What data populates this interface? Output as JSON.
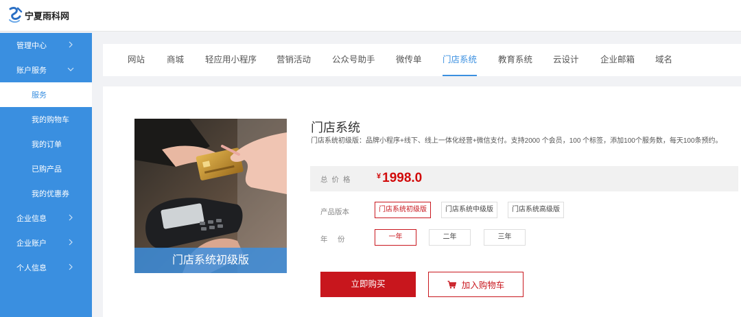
{
  "header": {
    "logo_text": "宁夏雨科网"
  },
  "sidebar": {
    "items": [
      {
        "label": "管理中心",
        "chevron": "right"
      },
      {
        "label": "账户服务",
        "chevron": "down"
      },
      {
        "label": "服务",
        "active": true
      },
      {
        "label": "我的购物车"
      },
      {
        "label": "我的订单"
      },
      {
        "label": "已购产品"
      },
      {
        "label": "我的优惠券"
      },
      {
        "label": "企业信息",
        "chevron": "right"
      },
      {
        "label": "企业账户",
        "chevron": "right"
      },
      {
        "label": "个人信息",
        "chevron": "right"
      }
    ]
  },
  "tabs": [
    {
      "label": "网站"
    },
    {
      "label": "商城"
    },
    {
      "label": "轻应用小程序"
    },
    {
      "label": "营销活动"
    },
    {
      "label": "公众号助手"
    },
    {
      "label": "微传单"
    },
    {
      "label": "门店系统",
      "active": true
    },
    {
      "label": "教育系统"
    },
    {
      "label": "云设计"
    },
    {
      "label": "企业邮箱"
    },
    {
      "label": "域名"
    }
  ],
  "product": {
    "image_caption": "门店系统初级版",
    "title": "门店系统",
    "description": "门店系统初级版：品牌小程序+线下、线上一体化经营+微信支付。支持2000 个会员，100 个标签，添加100个服务数，每天100条预约。",
    "price_label": "总价格",
    "currency": "¥",
    "price": "1998.0",
    "version_label": "产品版本",
    "versions": [
      "门店系统初级版",
      "门店系统中级版",
      "门店系统高级版"
    ],
    "selected_version": "门店系统初级版",
    "year_label": "年　份",
    "years": [
      "一年",
      "二年",
      "三年"
    ],
    "selected_year": "一年",
    "buy_label": "立即购买",
    "cart_label": "加入购物车"
  },
  "colors": {
    "primary": "#3a8fe0",
    "accent": "#c8161d"
  }
}
